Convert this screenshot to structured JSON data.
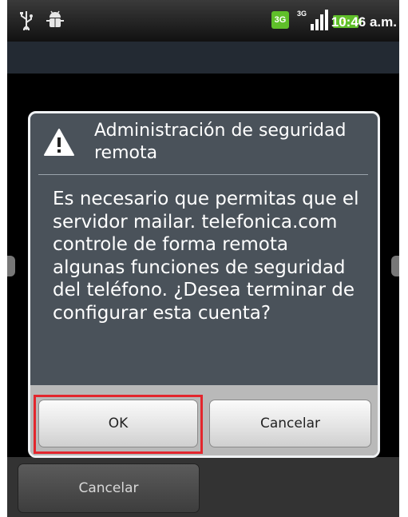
{
  "status_bar": {
    "icons": [
      "usb-icon",
      "android-debug-icon",
      "network-3g-icon",
      "signal-strength-icon",
      "battery-charging-icon"
    ],
    "network_label": "3G",
    "network_small_label": "3G",
    "time": "10:46 a.m."
  },
  "dialog": {
    "icon": "warning-icon",
    "title": "Administración de seguridad remota",
    "message": "Es necesario que permitas que el servidor mailar. telefonica.com controle de forma remota algunas funciones de seguridad del teléfono. ¿Desea terminar de configurar esta cuenta?",
    "ok_label": "OK",
    "cancel_label": "Cancelar"
  },
  "bottom_bar": {
    "cancel_label": "Cancelar"
  },
  "colors": {
    "dialog_bg": "#4a525a",
    "highlight": "#e3262d",
    "network_green": "#5fbf2a"
  }
}
